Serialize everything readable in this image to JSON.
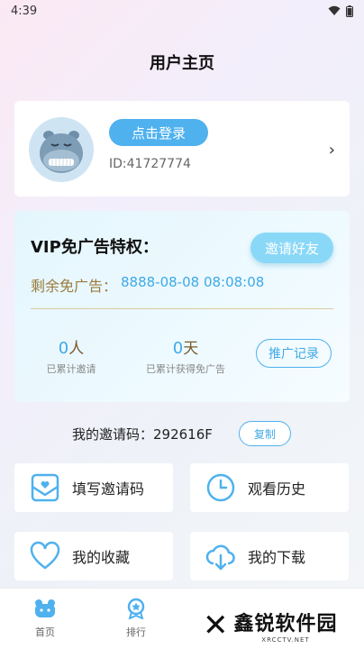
{
  "status_bar": {
    "time": "4:39"
  },
  "header": {
    "title": "用户主页"
  },
  "profile": {
    "login_label": "点击登录",
    "user_id": "ID:41727774",
    "chevron": "›"
  },
  "vip": {
    "title": "VIP免广告特权：",
    "invite_label": "邀请好友",
    "remain_label": "剩余免广告：",
    "remain_value": "8888-08-08 08:08:08",
    "stat_invited": {
      "num": "0",
      "unit": "人",
      "label": "已累计邀请"
    },
    "stat_days": {
      "num": "0",
      "unit": "天",
      "label": "已累计获得免广告"
    },
    "promo_label": "推广记录"
  },
  "invite_code": {
    "text": "我的邀请码：292616F",
    "copy_label": "复制"
  },
  "menu": [
    {
      "label": "填写邀请码",
      "icon": "mail-icon"
    },
    {
      "label": "观看历史",
      "icon": "clock-icon"
    },
    {
      "label": "我的收藏",
      "icon": "heart-icon"
    },
    {
      "label": "我的下载",
      "icon": "cloud-download-icon"
    }
  ],
  "bottom_nav": [
    {
      "label": "首页",
      "icon": "home-icon"
    },
    {
      "label": "排行",
      "icon": "rank-icon"
    }
  ],
  "watermark": {
    "cn": "鑫锐软件园",
    "en": "XRCCTV.NET"
  },
  "colors": {
    "accent": "#4fb1ee",
    "gold": "#9a7c3e"
  }
}
